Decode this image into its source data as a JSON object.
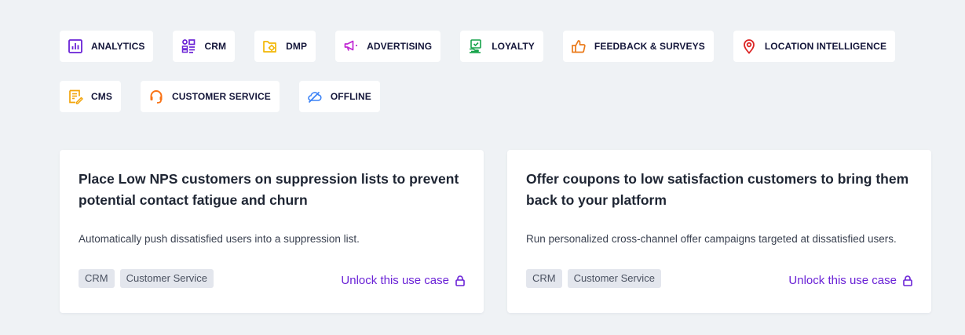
{
  "filters": {
    "row1": [
      {
        "label": "ANALYTICS",
        "icon": "analytics-chart-icon",
        "color": "#6a22d6"
      },
      {
        "label": "CRM",
        "icon": "crm-grid-icon",
        "color": "#6a22d6"
      },
      {
        "label": "DMP",
        "icon": "dmp-folder-gear-icon",
        "color": "#f2b705"
      },
      {
        "label": "ADVERTISING",
        "icon": "megaphone-icon",
        "color": "#c026d3"
      },
      {
        "label": "LOYALTY",
        "icon": "loyalty-badge-icon",
        "color": "#16a34a"
      },
      {
        "label": "FEEDBACK & SURVEYS",
        "icon": "thumbs-up-icon",
        "color": "#ea7a1a"
      },
      {
        "label": "LOCATION INTELLIGENCE",
        "icon": "map-pin-icon",
        "color": "#dc2626"
      }
    ],
    "row2": [
      {
        "label": "CMS",
        "icon": "cms-document-icon",
        "color": "#f2a40a"
      },
      {
        "label": "CUSTOMER SERVICE",
        "icon": "headset-icon",
        "color": "#f97316"
      },
      {
        "label": "OFFLINE",
        "icon": "offline-cloud-icon",
        "color": "#3b82f6"
      }
    ]
  },
  "cards": [
    {
      "title": "Place Low NPS customers on suppression lists to prevent potential contact fatigue and churn",
      "description": "Automatically push dissatisfied users into a suppression list.",
      "tags": [
        "CRM",
        "Customer Service"
      ],
      "cta": "Unlock this use case"
    },
    {
      "title": "Offer coupons to low satisfaction customers to bring them back to your platform",
      "description": "Run personalized cross-channel offer campaigns targeted at dissatisfied users.",
      "tags": [
        "CRM",
        "Customer Service"
      ],
      "cta": "Unlock this use case"
    }
  ],
  "colors": {
    "background": "#eff2f5",
    "accent": "#6a22d6",
    "tag_bg": "#e3e6ed"
  }
}
